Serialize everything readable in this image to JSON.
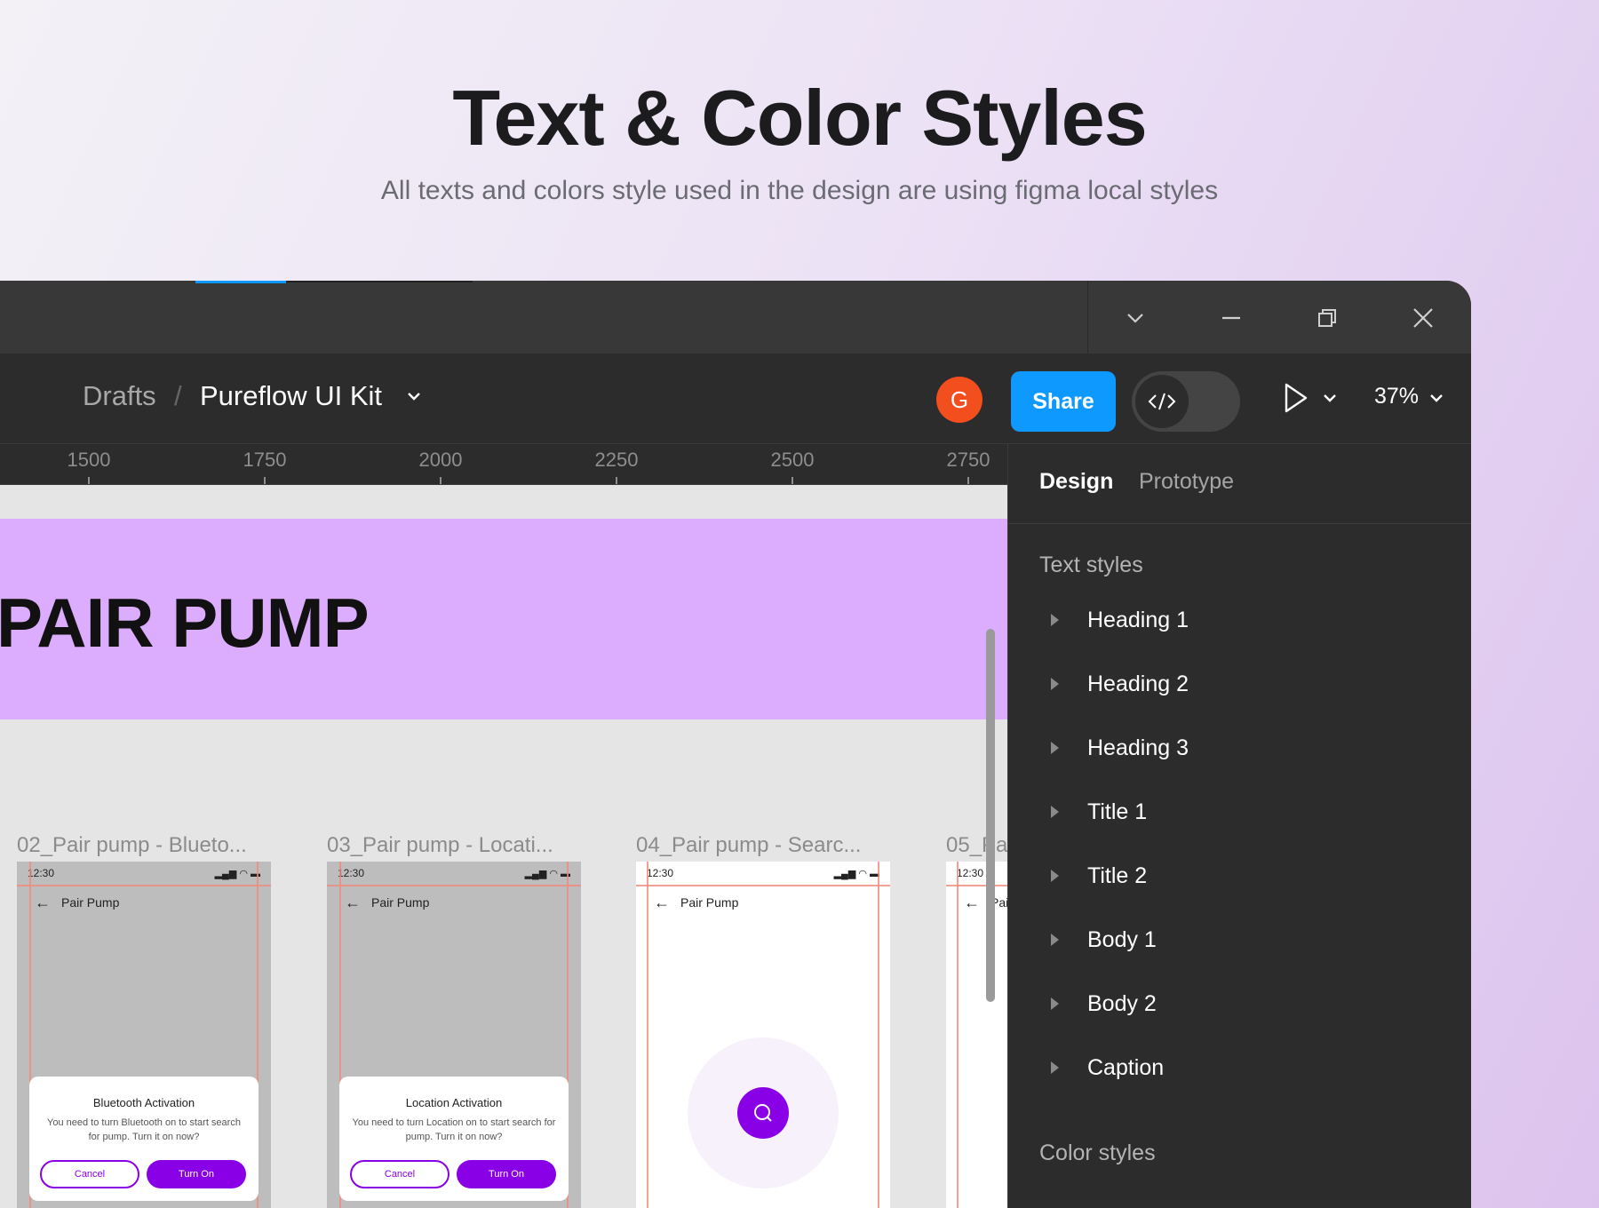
{
  "hero": {
    "title": "Text & Color Styles",
    "subtitle": "All texts and colors style used in the design are using figma local styles"
  },
  "window_controls": {
    "icons": [
      "chevron-down-icon",
      "minimize-icon",
      "restore-icon",
      "close-icon"
    ]
  },
  "toolbar": {
    "breadcrumb_root": "Drafts",
    "breadcrumb_separator": "/",
    "file_name": "Pureflow UI Kit",
    "avatar_initial": "G",
    "avatar_color": "#f24e1e",
    "share_label": "Share",
    "share_color": "#0d99ff",
    "zoom": "37%"
  },
  "ruler": {
    "labels": [
      "1500",
      "1750",
      "2000",
      "2250",
      "2500",
      "2750"
    ]
  },
  "canvas": {
    "banner_text": "PAIR PUMP",
    "banner_color": "#dcacff",
    "frames": [
      {
        "label": "02_Pair pump - Blueto...",
        "time": "12:30",
        "nav_title": "Pair Pump",
        "sheet_title": "Bluetooth Activation",
        "sheet_body": "You need to turn Bluetooth on to start search for pump. Turn it on now?",
        "cancel": "Cancel",
        "confirm": "Turn On"
      },
      {
        "label": "03_Pair pump - Locati...",
        "time": "12:30",
        "nav_title": "Pair Pump",
        "sheet_title": "Location Activation",
        "sheet_body": "You need to turn Location on to start search for pump. Turn it on now?",
        "cancel": "Cancel",
        "confirm": "Turn On"
      },
      {
        "label": "04_Pair pump - Searc...",
        "time": "12:30",
        "nav_title": "Pair Pump"
      },
      {
        "label": "05_Pa",
        "time": "12:30",
        "nav_title": "Pai"
      }
    ],
    "accent_color": "#8a00e6"
  },
  "panel": {
    "tabs": [
      "Design",
      "Prototype"
    ],
    "text_styles_title": "Text styles",
    "text_styles": [
      "Heading 1",
      "Heading 2",
      "Heading 3",
      "Title 1",
      "Title 2",
      "Body 1",
      "Body 2",
      "Caption"
    ],
    "color_styles_title": "Color styles"
  }
}
